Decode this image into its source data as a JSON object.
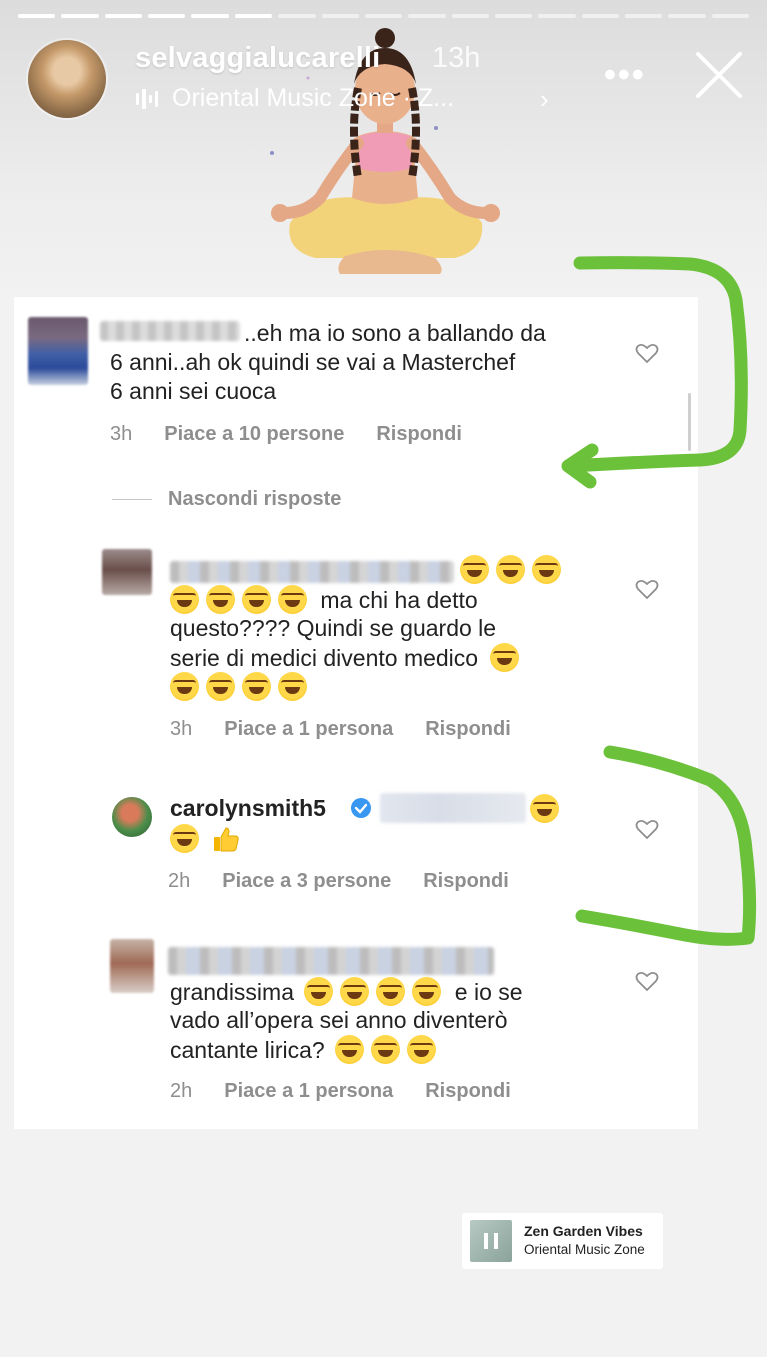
{
  "story": {
    "segments_total": 17,
    "segments_done": 6
  },
  "header": {
    "username": "selvaggialucarelli",
    "time": "13h",
    "music_label": "Oriental Music Zone · Z...",
    "more_icon": "more-horizontal-icon",
    "close_icon": "close-icon"
  },
  "comments": [
    {
      "text": "..eh ma io sono a ballando da 6 anni..ah ok quindi se vai a Masterchef 6 anni sei cuoca",
      "line1": "..eh ma io sono a ballando da",
      "line2": "6 anni..ah ok quindi se vai a Masterchef",
      "line3": "6 anni sei cuoca",
      "time": "3h",
      "likes": "Piace a 10 persone",
      "reply": "Rispondi"
    },
    {
      "line1b": "ma chi ha detto",
      "line2": "questo???? Quindi se guardo le",
      "line3": "serie di medici divento medico",
      "time": "3h",
      "likes": "Piace a 1 persona",
      "reply": "Rispondi"
    },
    {
      "author": "carolynsmith5",
      "time": "2h",
      "likes": "Piace a 3 persone",
      "reply": "Rispondi"
    },
    {
      "line1a": "grandissima",
      "line1b": "e io se",
      "line2": "vado all’opera sei anno diventerò",
      "line3": "cantante lirica?",
      "time": "2h",
      "likes": "Piace a 1 persona",
      "reply": "Rispondi"
    }
  ],
  "hide_replies": "Nascondi risposte",
  "music_sticker": {
    "title": "Zen Garden Vibes",
    "artist": "Oriental Music Zone"
  },
  "colors": {
    "annotation_green": "#6cc13b",
    "meta_gray": "#8e8e8e",
    "verified_blue": "#3897f0"
  }
}
